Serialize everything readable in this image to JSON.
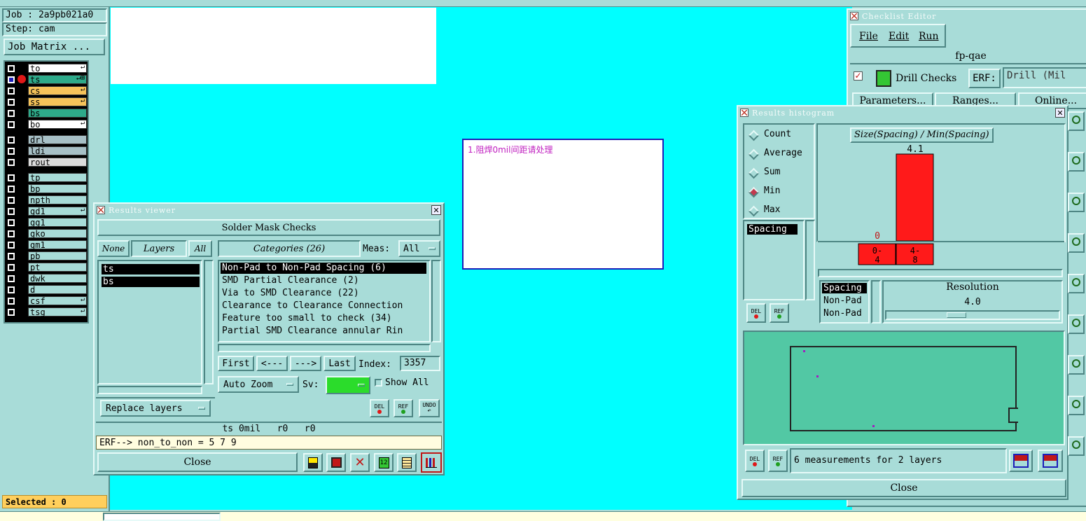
{
  "job_panel": {
    "job_label": "Job : 2a9pb021a0",
    "step_label": "Step: cam",
    "job_matrix_button": "Job Matrix ...",
    "selected_label": "Selected : 0",
    "layer_groups": [
      [
        {
          "name": "to",
          "color": "#ffffff",
          "mark": "↵"
        },
        {
          "name": "ts",
          "color": "#2eaa8a",
          "mark": "↵⊞"
        },
        {
          "name": "cs",
          "color": "#f6c35a",
          "mark": "↵"
        },
        {
          "name": "ss",
          "color": "#f6c35a",
          "mark": "↵"
        },
        {
          "name": "bs",
          "color": "#2eaa8a",
          "mark": ""
        },
        {
          "name": "bo",
          "color": "#ffffff",
          "mark": "↵"
        }
      ],
      [
        {
          "name": "drl",
          "color": "#a7c0c6",
          "mark": ""
        },
        {
          "name": "ldi",
          "color": "#a7c0c6",
          "mark": ""
        },
        {
          "name": "rout",
          "color": "#dcdcdc",
          "mark": ""
        }
      ],
      [
        {
          "name": "tp",
          "color": "#a8dcd8",
          "mark": ""
        },
        {
          "name": "bp",
          "color": "#a8dcd8",
          "mark": ""
        },
        {
          "name": "npth",
          "color": "#a8dcd8",
          "mark": ""
        },
        {
          "name": "gd1",
          "color": "#a8dcd8",
          "mark": "↵"
        },
        {
          "name": "gg1",
          "color": "#a8dcd8",
          "mark": ""
        },
        {
          "name": "gko",
          "color": "#a8dcd8",
          "mark": ""
        },
        {
          "name": "gm1",
          "color": "#a8dcd8",
          "mark": ""
        },
        {
          "name": "pb",
          "color": "#a8dcd8",
          "mark": ""
        },
        {
          "name": "pt",
          "color": "#a8dcd8",
          "mark": ""
        },
        {
          "name": "dwk",
          "color": "#a8dcd8",
          "mark": ""
        },
        {
          "name": "d",
          "color": "#a8dcd8",
          "mark": ""
        },
        {
          "name": "csf",
          "color": "#a8dcd8",
          "mark": "↵"
        },
        {
          "name": "tsg",
          "color": "#a8dcd8",
          "mark": "↵"
        }
      ]
    ]
  },
  "canvas": {
    "note_text": "1.阻焊0mil间距请处理"
  },
  "results_viewer": {
    "title": "Results viewer",
    "header": "Solder Mask Checks",
    "none_btn": "None",
    "layers_label": "Layers",
    "all_btn": "All",
    "layers": [
      "ts",
      "bs"
    ],
    "categories_label": "Categories (26)",
    "meas_label": "Meas:",
    "meas_value": "All",
    "categories": [
      "Non-Pad to Non-Pad Spacing (6)",
      "SMD Partial Clearance (2)",
      "Via to SMD Clearance (22)",
      "Clearance to Clearance Connection",
      "Feature too small to check (34)",
      "Partial SMD Clearance annular Rin"
    ],
    "first_btn": "First",
    "prev_btn": "<---",
    "next_btn": "--->",
    "last_btn": "Last",
    "index_label": "Index:",
    "index_value": "3357",
    "auto_zoom": "Auto Zoom",
    "sv_label": "Sv:",
    "show_all": "Show All",
    "replace_layers": "Replace layers",
    "del_label": "DEL",
    "ref_label": "REF",
    "undo_label": "UNDO",
    "status_line": "ts 0mil   r0   r0",
    "erf_line": "ERF--> non_to_non = 5 7 9",
    "close_btn": "Close"
  },
  "checklist_editor": {
    "title": "Checklist Editor",
    "menu": [
      "File",
      "Edit",
      "Run"
    ],
    "list_name": "fp-qae",
    "check_name": "Drill Checks",
    "erf_label": "ERF:",
    "erf_value": "Drill (Mil",
    "parameters_btn": "Parameters...",
    "ranges_btn": "Ranges...",
    "online_btn": "Online..."
  },
  "histogram": {
    "title": "Results histogram",
    "modes": [
      "Count",
      "Average",
      "Sum",
      "Min",
      "Max"
    ],
    "selected_mode": "Min",
    "measure_list": [
      "Spacing"
    ],
    "chart_title": "Size(Spacing) / Min(Spacing)",
    "resolution_label": "Resolution",
    "resolution_value": "4.0",
    "lower_list": [
      "Spacing",
      "Non-Pad",
      "Non-Pad"
    ],
    "del_label": "DEL",
    "ref_label": "REF",
    "measurements_text": "6 measurements for 2 layers",
    "close_btn": "Close"
  },
  "chart_data": {
    "type": "bar",
    "title": "Size(Spacing) / Min(Spacing)",
    "categories": [
      "0-4",
      "4-8"
    ],
    "values": [
      0,
      4.1
    ],
    "value_labels": [
      "0",
      "4.1"
    ],
    "colors": {
      "bar": "#ff1a1a"
    }
  },
  "colors": {
    "canvas": "#00ffff",
    "panel": "#a8dcd8",
    "highlight": "#ffcf5c",
    "input_bg": "#fffde0"
  }
}
